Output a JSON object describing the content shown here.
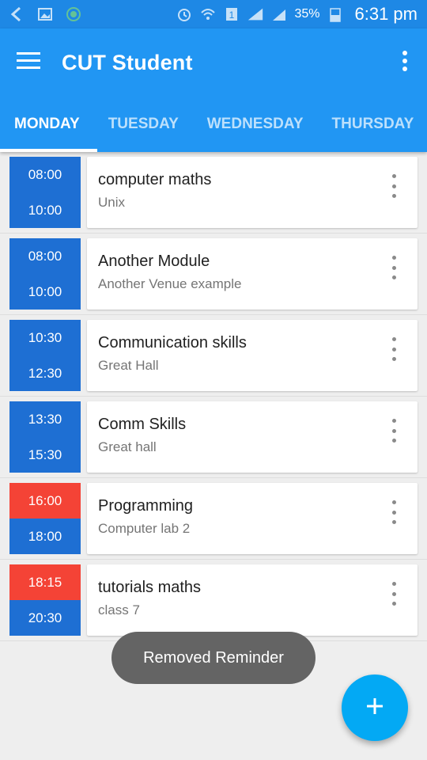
{
  "status_bar": {
    "battery": "35%",
    "time": "6:31 pm",
    "icons": [
      "back-arrow-icon",
      "image-icon",
      "app-notification-icon",
      "alarm-icon",
      "wifi-icon",
      "sim-icon",
      "signal-icon",
      "battery-icon"
    ]
  },
  "app_bar": {
    "title": "CUT Student",
    "menu_icon": "hamburger-menu-icon",
    "overflow_icon": "more-vert-icon",
    "color": "#2196f3"
  },
  "tabs": [
    {
      "label": "MONDAY",
      "active": true
    },
    {
      "label": "TUESDAY",
      "active": false
    },
    {
      "label": "WEDNESDAY",
      "active": false
    },
    {
      "label": "THURSDAY",
      "active": false
    }
  ],
  "classes": [
    {
      "start": "08:00",
      "end": "10:00",
      "module": "computer maths",
      "venue": "Unix",
      "start_alert": false
    },
    {
      "start": "08:00",
      "end": "10:00",
      "module": "Another Module",
      "venue": "Another Venue example",
      "start_alert": false
    },
    {
      "start": "10:30",
      "end": "12:30",
      "module": "Communication skills",
      "venue": "Great Hall",
      "start_alert": false
    },
    {
      "start": "13:30",
      "end": "15:30",
      "module": "Comm Skills",
      "venue": "Great hall",
      "start_alert": false
    },
    {
      "start": "16:00",
      "end": "18:00",
      "module": "Programming",
      "venue": "Computer lab 2",
      "start_alert": true
    },
    {
      "start": "18:15",
      "end": "20:30",
      "module": "tutorials maths",
      "venue": "class 7",
      "start_alert": true
    }
  ],
  "colors": {
    "time_blue": "#1e6fd3",
    "time_alert": "#f44336",
    "fab": "#03a9f4"
  },
  "toast": {
    "text": "Removed Reminder"
  },
  "fab": {
    "icon": "plus-icon"
  }
}
